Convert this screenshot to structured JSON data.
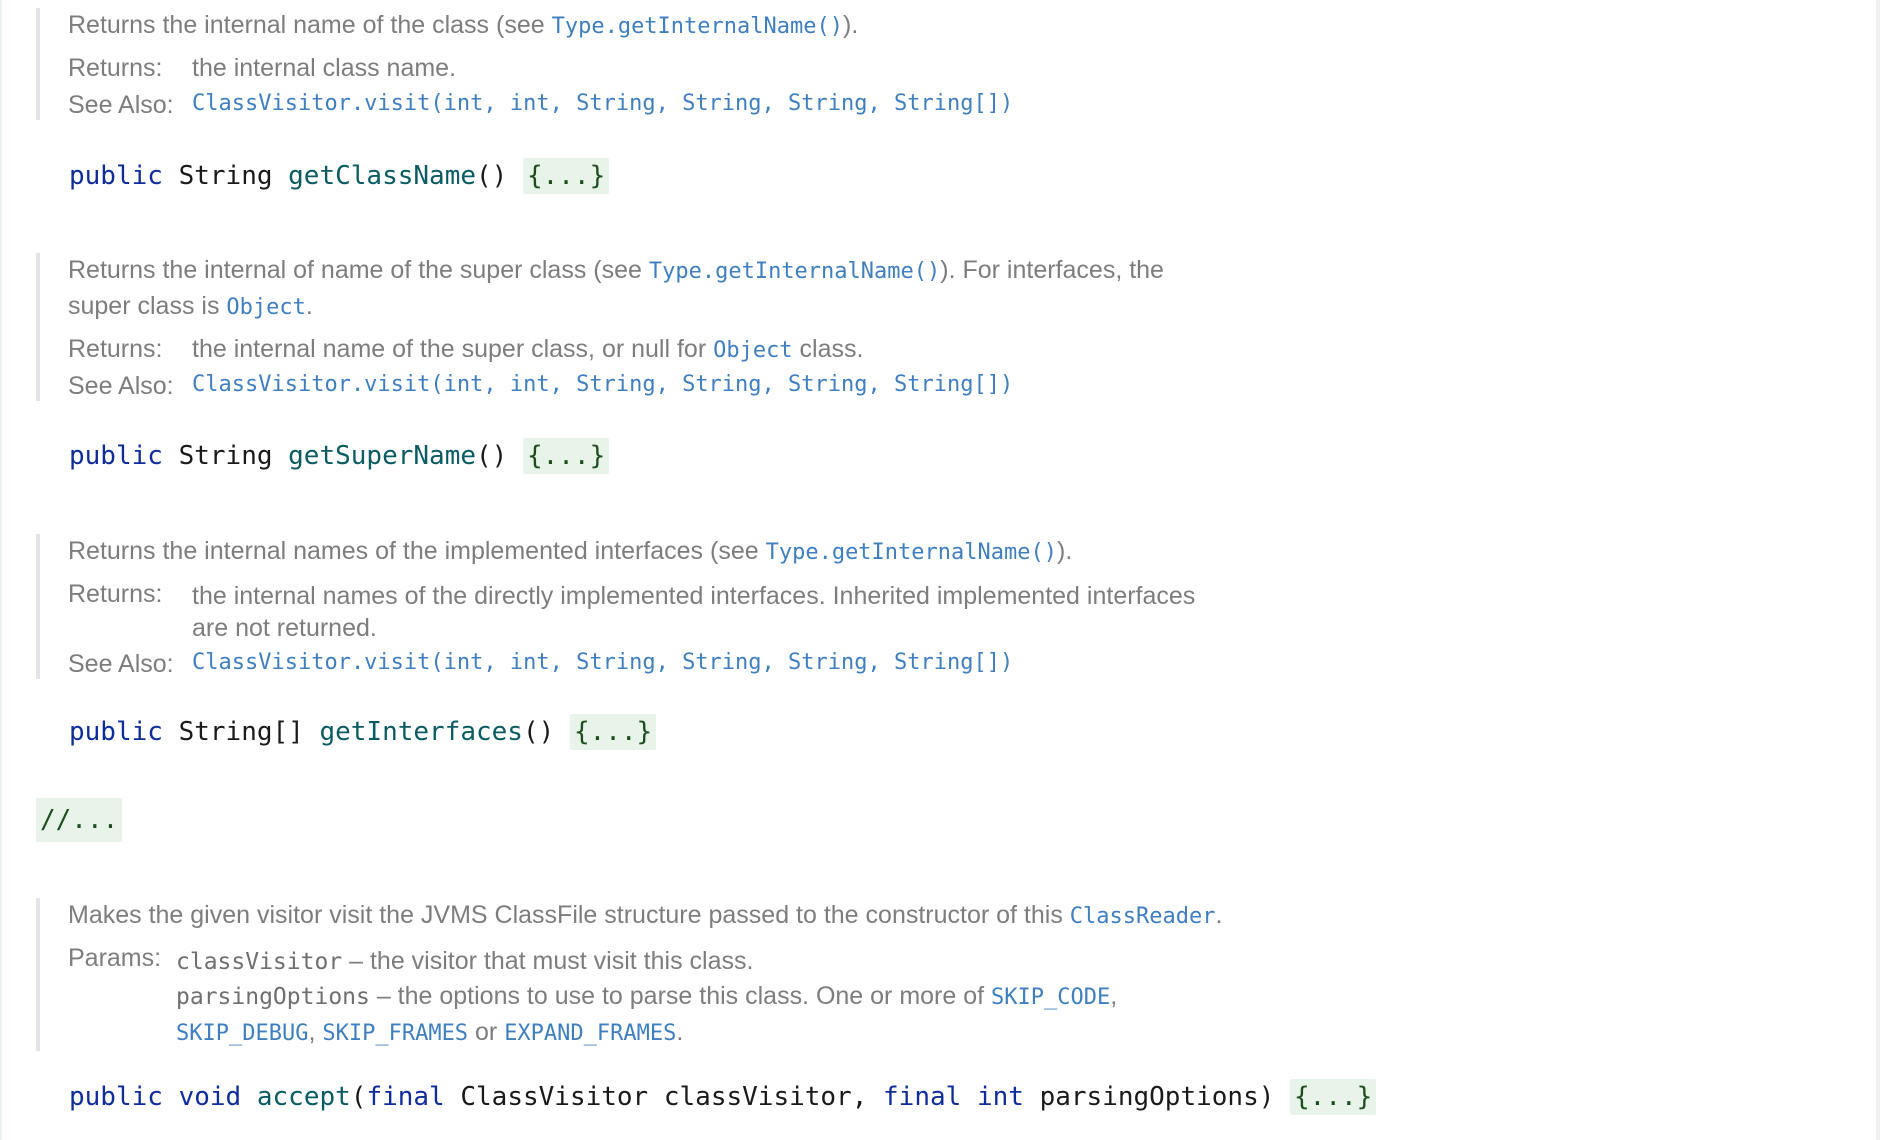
{
  "docs": [
    {
      "desc_before": "Returns the internal name of the class (see ",
      "desc_link": "Type.getInternalName()",
      "desc_after": ").",
      "returns_label": "Returns:",
      "returns_text": "the internal class name.",
      "see_label": "See Also:",
      "see_link": "ClassVisitor.visit(int, int, String, String, String, String[])",
      "sig": {
        "mod": "public",
        "type": "String",
        "method": "getClassName",
        "args": "()",
        "fold": "{...}"
      }
    },
    {
      "desc_before": "Returns the internal of name of the super class (see ",
      "desc_link": "Type.getInternalName()",
      "desc_after": "). For interfaces, the",
      "desc_line2_before": "super class is ",
      "desc_line2_link": "Object",
      "desc_line2_after": ".",
      "returns_label": "Returns:",
      "returns_before": "the internal name of the super class, or null for ",
      "returns_link": "Object",
      "returns_after": " class.",
      "see_label": "See Also:",
      "see_link": "ClassVisitor.visit(int, int, String, String, String, String[])",
      "sig": {
        "mod": "public",
        "type": "String",
        "method": "getSuperName",
        "args": "()",
        "fold": "{...}"
      }
    },
    {
      "desc_before": "Returns the internal names of the implemented interfaces (see ",
      "desc_link": "Type.getInternalName()",
      "desc_after": ").",
      "returns_label": "Returns:",
      "returns_line1": "the internal names of the directly implemented interfaces. Inherited implemented interfaces",
      "returns_line2": "are not returned.",
      "see_label": "See Also:",
      "see_link": "ClassVisitor.visit(int, int, String, String, String, String[])",
      "sig": {
        "mod": "public",
        "type": "String[]",
        "method": "getInterfaces",
        "args": "()",
        "fold": "{...}"
      }
    },
    {
      "desc_before": "Makes the given visitor visit the JVMS ClassFile structure passed to the constructor of this ",
      "desc_link": "ClassReader",
      "desc_after": ".",
      "params_label": "Params:",
      "param1_name": "classVisitor",
      "param1_desc": " – the visitor that must visit this class.",
      "param2_name": "parsingOptions",
      "param2_desc": " – the options to use to parse this class. One or more of ",
      "param2_link1": "SKIP_CODE",
      "param2_sep1": ",",
      "param2_link2": "SKIP_DEBUG",
      "param2_sep2": ", ",
      "param2_link3": "SKIP_FRAMES",
      "param2_sep3": " or ",
      "param2_link4": "EXPAND_FRAMES",
      "param2_end": ".",
      "sig": {
        "mod": "public",
        "ret": "void",
        "method": "accept",
        "open": "(",
        "final1": "final",
        "type1": " ClassVisitor classVisitor, ",
        "final2": "final",
        "int": "int",
        "type2": " parsingOptions)",
        "fold": "{...}"
      }
    }
  ],
  "fold_comment": "//..."
}
